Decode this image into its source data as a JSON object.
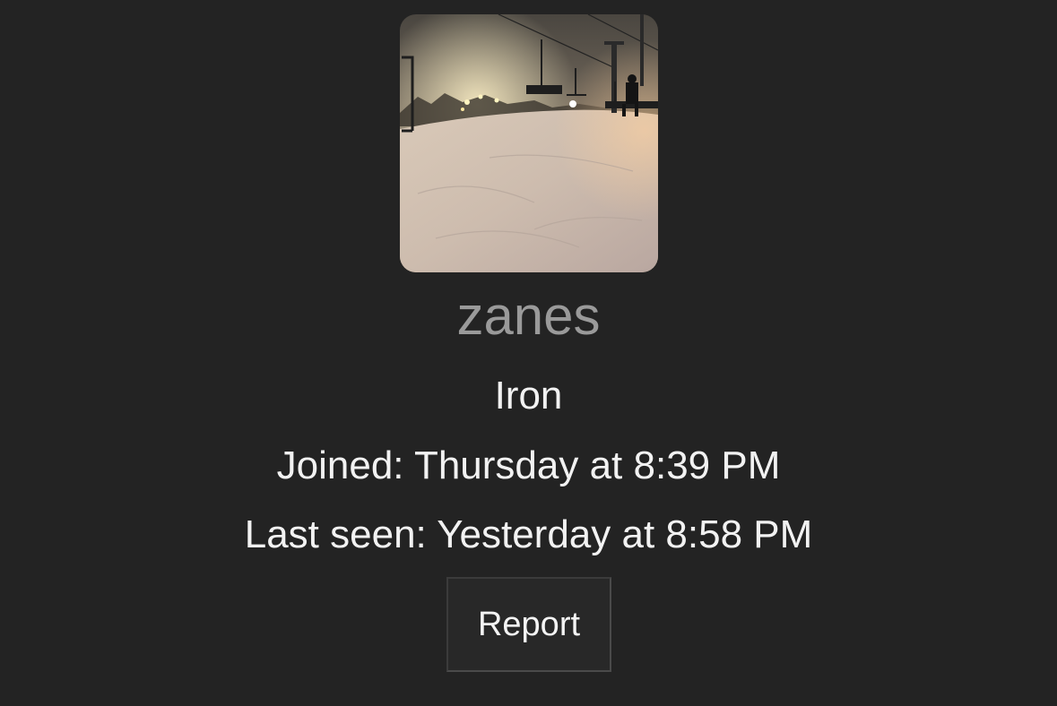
{
  "profile": {
    "avatar_icon": "ski-slope-night-photo",
    "username": "zanes",
    "rank": "Iron",
    "joined": "Joined: Thursday at 8:39 PM",
    "last_seen": "Last seen: Yesterday at 8:58 PM"
  },
  "actions": {
    "report_label": "Report"
  },
  "colors": {
    "background": "#232323",
    "username": "#9a9a9a",
    "text": "#f2f2f2",
    "button_bg": "#282828"
  }
}
